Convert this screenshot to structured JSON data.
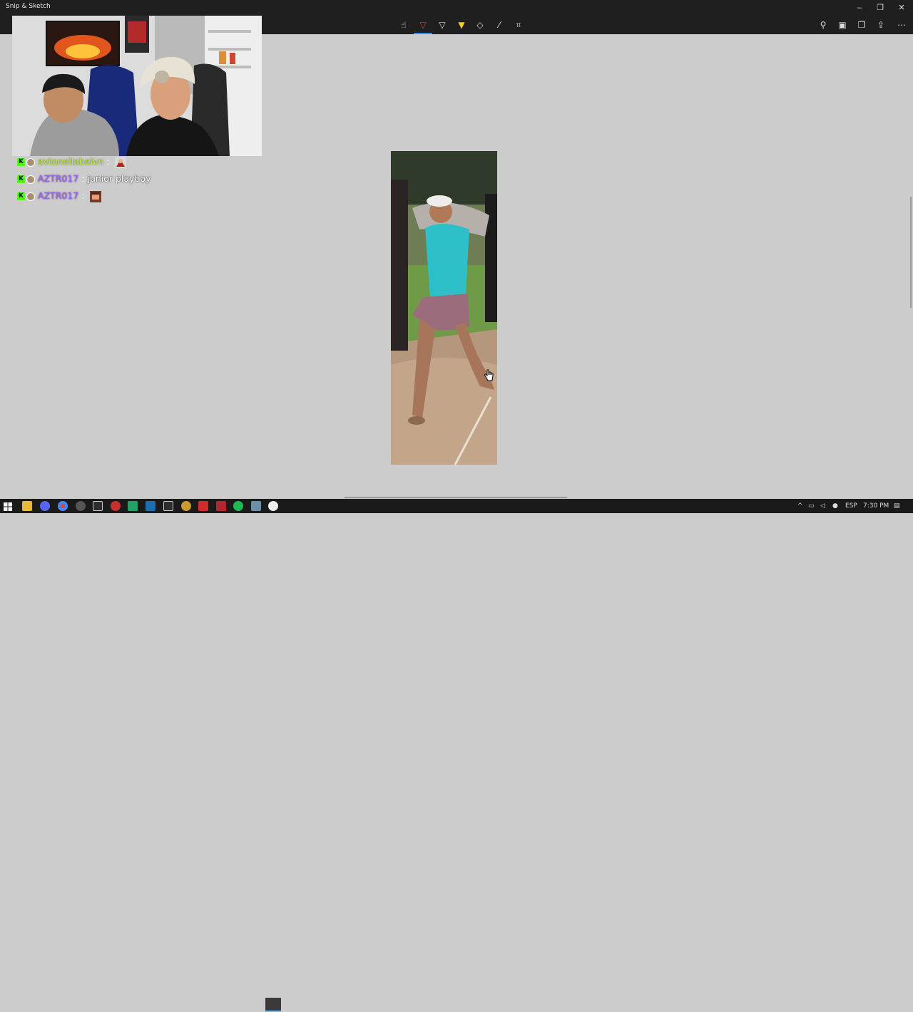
{
  "window": {
    "title": "Snip & Sketch",
    "controls": {
      "minimize": "–",
      "restore": "❐",
      "close": "✕"
    }
  },
  "toolbar": {
    "tools": [
      {
        "name": "touch-writing-icon",
        "glyph": "☝"
      },
      {
        "name": "ballpoint-pen-icon",
        "glyph": "▽",
        "active": true
      },
      {
        "name": "pencil-icon",
        "glyph": "▽"
      },
      {
        "name": "highlighter-icon",
        "glyph": "▼"
      },
      {
        "name": "eraser-icon",
        "glyph": "◇"
      },
      {
        "name": "ruler-icon",
        "glyph": "⁄"
      },
      {
        "name": "crop-icon",
        "glyph": "⌗"
      }
    ],
    "right_tools": [
      {
        "name": "zoom-icon",
        "glyph": "⚲"
      },
      {
        "name": "save-icon",
        "glyph": "▣"
      },
      {
        "name": "copy-icon",
        "glyph": "❐"
      },
      {
        "name": "share-icon",
        "glyph": "⇪"
      },
      {
        "name": "more-icon",
        "glyph": "⋯"
      }
    ]
  },
  "chat": {
    "messages": [
      {
        "user": "avtonellabelvn",
        "separator": ":",
        "text": "",
        "emote": true,
        "user_color": "#b7e64b"
      },
      {
        "user": "AZTR017",
        "separator": ":",
        "text": "junior playboy",
        "emote": false,
        "user_color": "#9d63e8"
      },
      {
        "user": "AZTR017",
        "separator": ":",
        "text": "",
        "emote": true,
        "user_color": "#9d63e8"
      }
    ],
    "badge": "K"
  },
  "taskbar": {
    "language": "ESP",
    "time": "7:30 PM"
  },
  "colors": {
    "titlebar": "#1f1f1f",
    "canvas": "#cccccc",
    "accent": "#3a8ee6",
    "kick_green": "#53fc18"
  }
}
